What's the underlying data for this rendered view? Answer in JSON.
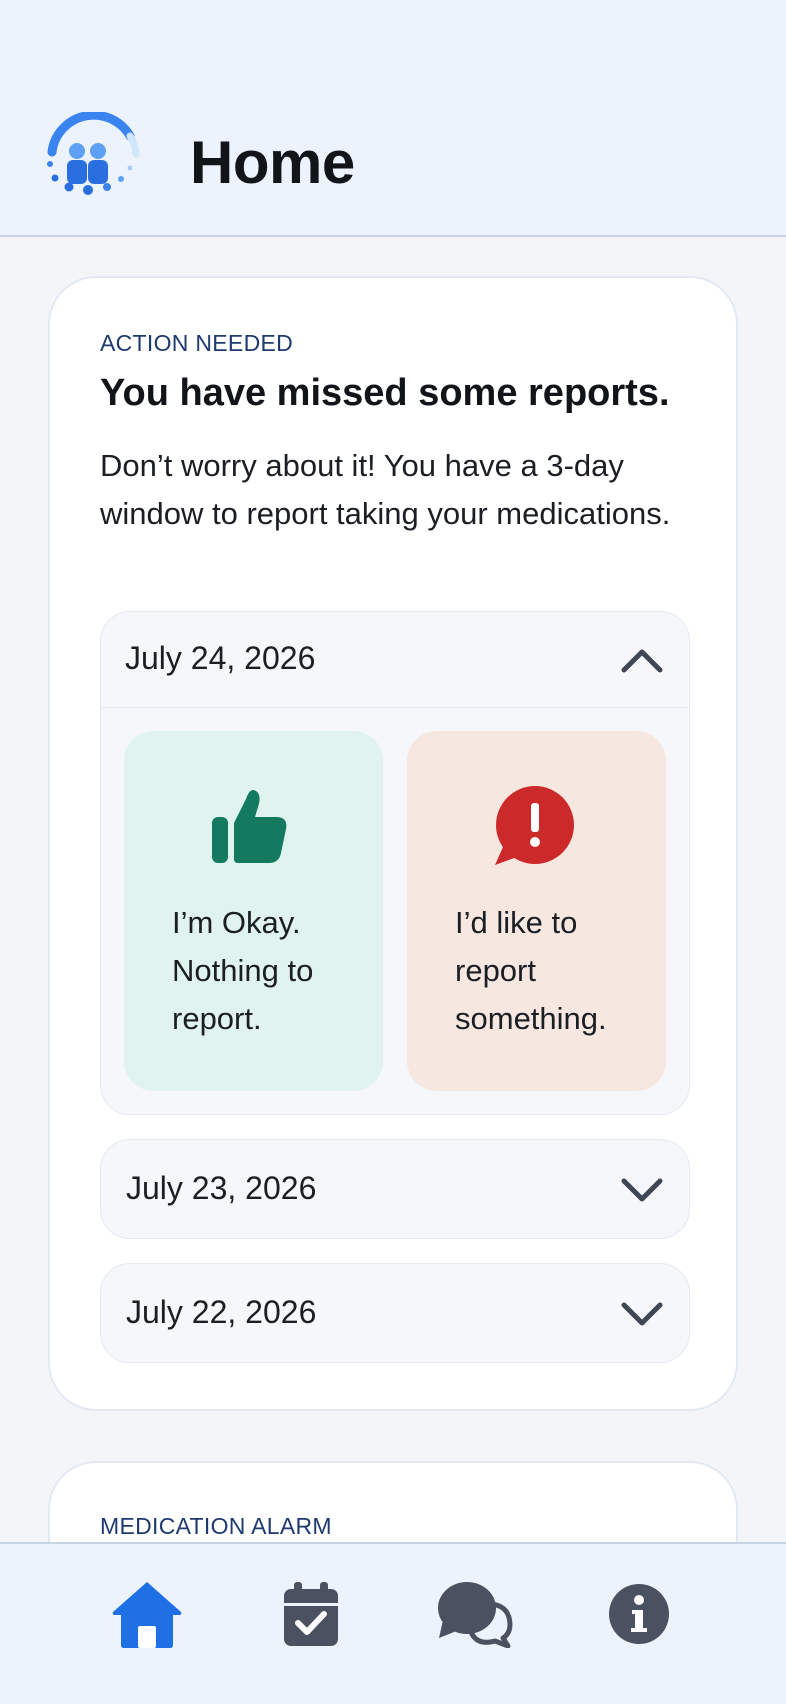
{
  "header": {
    "title": "Home",
    "logo_icon": "care-team-logo-icon"
  },
  "action_card": {
    "eyebrow": "ACTION NEEDED",
    "title": "You have missed some reports.",
    "description": "Don’t worry about it! You have a 3-day window to report taking your medications.",
    "days": [
      {
        "date": "July 24, 2026",
        "expanded": true,
        "options": [
          {
            "label": "I’m Okay. Nothing to report.",
            "icon": "thumbs-up-icon",
            "color": "#147a5f"
          },
          {
            "label": "I’d like to report something.",
            "icon": "alert-bubble-icon",
            "color": "#cc2a2a"
          }
        ]
      },
      {
        "date": "July 23, 2026",
        "expanded": false
      },
      {
        "date": "July 22, 2026",
        "expanded": false
      }
    ]
  },
  "alarm_card": {
    "eyebrow": "MEDICATION ALARM"
  },
  "bottom_nav": {
    "active": "home",
    "items": [
      {
        "id": "home",
        "icon": "home-icon"
      },
      {
        "id": "calendar",
        "icon": "calendar-check-icon"
      },
      {
        "id": "messages",
        "icon": "chat-bubbles-icon"
      },
      {
        "id": "info",
        "icon": "info-icon"
      }
    ]
  },
  "colors": {
    "accent": "#1f6fe5",
    "header_bg": "#edf3fc",
    "ok_bg": "#e0f3ee",
    "report_bg": "#f6e8e1",
    "nav_inactive": "#4a5160"
  }
}
